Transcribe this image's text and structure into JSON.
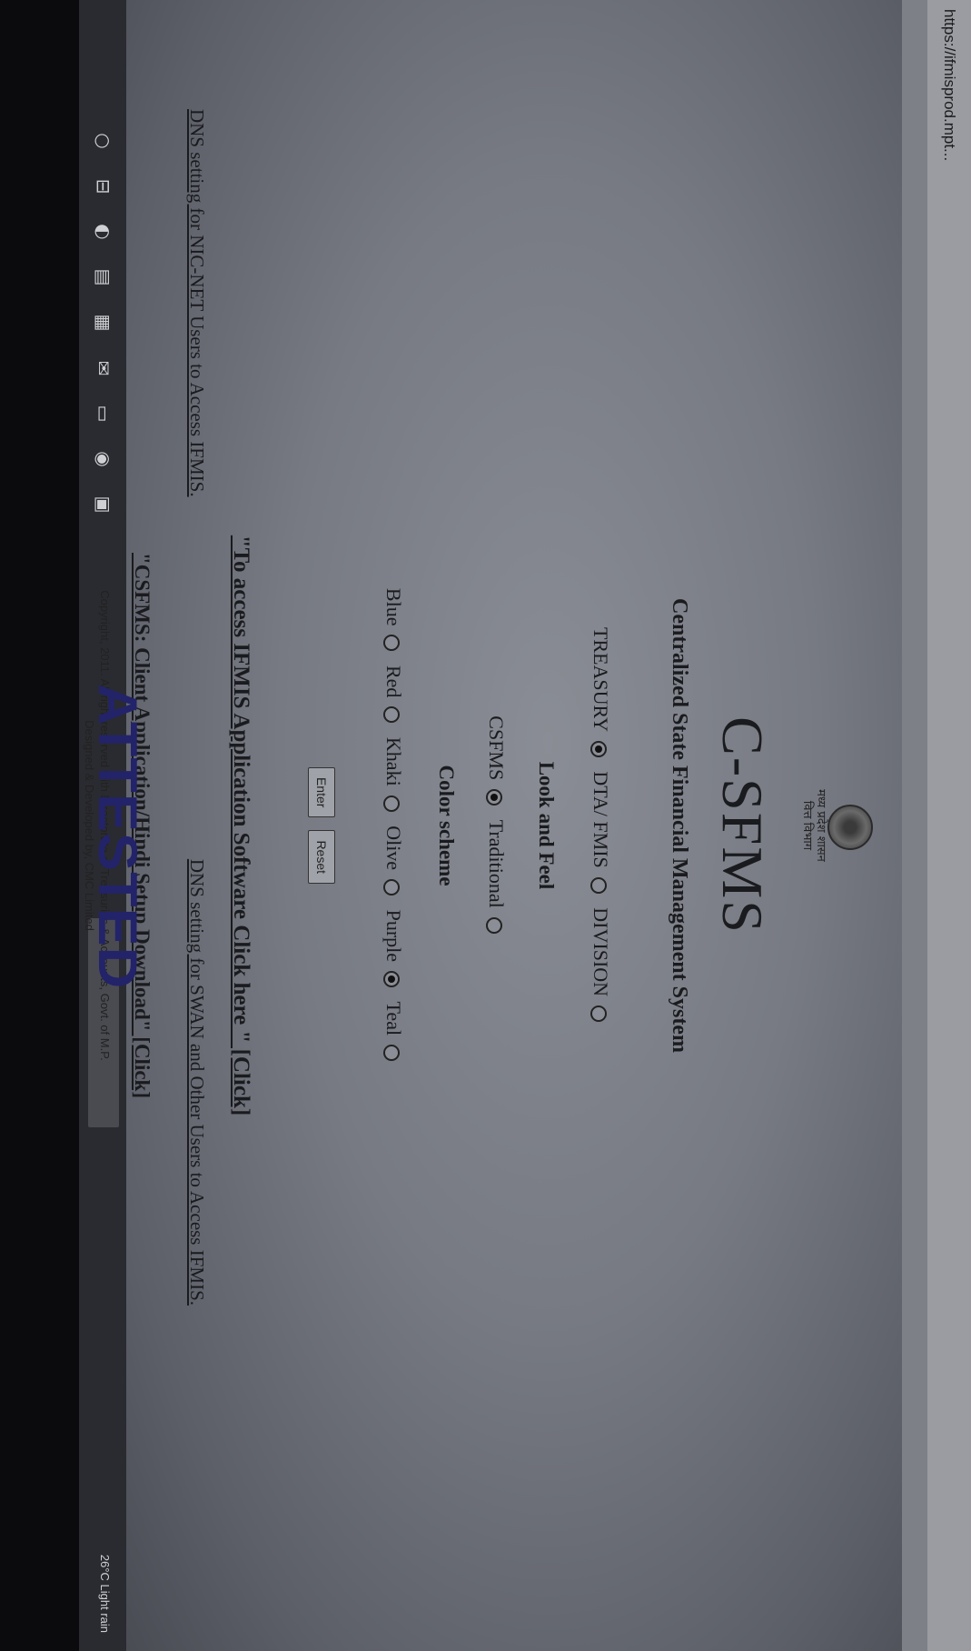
{
  "browser": {
    "address": "https://ifmisprod.mpt..."
  },
  "header": {
    "emblem_text_line1": "मध्य प्रदेश शासन",
    "emblem_text_line2": "वित्त विभाग",
    "title": "C-SFMS",
    "subtitle": "Centralized State Financial Management System"
  },
  "office": {
    "options": [
      {
        "label": "TREASURY",
        "selected": true
      },
      {
        "label": "DTA/ FMIS",
        "selected": false
      },
      {
        "label": "DIVISION",
        "selected": false
      }
    ]
  },
  "look": {
    "title": "Look and Feel",
    "options": [
      {
        "label": "CSFMS",
        "selected": true
      },
      {
        "label": "Traditional",
        "selected": false
      }
    ]
  },
  "colors": {
    "title": "Color scheme",
    "options": [
      {
        "label": "Blue",
        "selected": false
      },
      {
        "label": "Red",
        "selected": false
      },
      {
        "label": "Khaki",
        "selected": false
      },
      {
        "label": "Olive",
        "selected": false
      },
      {
        "label": "Purple",
        "selected": true
      },
      {
        "label": "Teal",
        "selected": false
      }
    ]
  },
  "buttons": {
    "enter": "Enter",
    "reset": "Reset"
  },
  "links": {
    "ifmis": "\"To access IFMIS Application Software Click here \" [Click]",
    "dns_nic": "DNS setting for NIC-NET Users to Access IFMIS.",
    "dns_swan": "DNS setting for SWAN and Other Users to Access IFMIS.",
    "client": "\"CSFMS: Client Application/Hindi Setup Download\" [Click]"
  },
  "footer": {
    "line1": "Copyright, 2011. All right reserved with Directorate of Treasuries & Accounts, Govt. of M.P.",
    "line2": "Designed & Developed by, CMC Limited"
  },
  "stamp": "ATTESTED",
  "taskbar": {
    "weather": "26°C Light rain",
    "icons": [
      "windows-icon",
      "task-view-icon",
      "edge-icon",
      "explorer-icon",
      "store-icon",
      "mail-icon",
      "folder-icon",
      "chrome-icon",
      "word-icon"
    ]
  }
}
